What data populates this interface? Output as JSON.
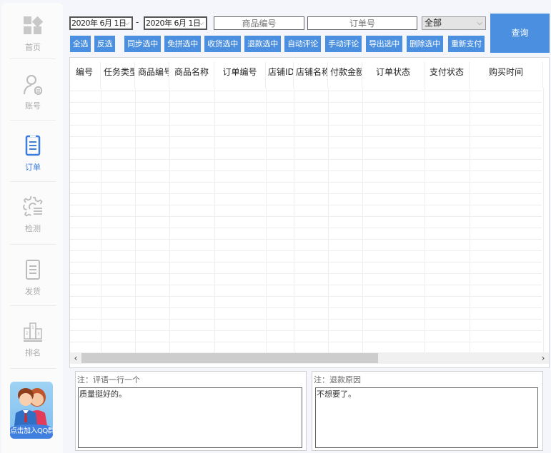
{
  "sidebar": {
    "items": [
      {
        "label": "首页",
        "icon": "home-grid-icon",
        "active": false
      },
      {
        "label": "账号",
        "icon": "user-account-icon",
        "active": false
      },
      {
        "label": "订单",
        "icon": "order-clipboard-icon",
        "active": true
      },
      {
        "label": "检测",
        "icon": "gear-check-icon",
        "active": false
      },
      {
        "label": "发货",
        "icon": "shipping-clipboard-icon",
        "active": false
      },
      {
        "label": "排名",
        "icon": "podium-ranking-icon",
        "active": false
      }
    ],
    "qq_group_label": "点击加入QQ群"
  },
  "toolbar": {
    "date_from": "2020年 6月 1日",
    "date_to": "2020年 6月 1日",
    "date_separator": "-",
    "product_id_placeholder": "商品编号",
    "order_no_placeholder": "订单号",
    "status_select": "全部",
    "query_label": "查询",
    "buttons": [
      "全选",
      "反选",
      "同步选中",
      "免拼选中",
      "收货选中",
      "退款选中",
      "自动评论",
      "手动评论",
      "导出选中",
      "删除选中",
      "重新支付"
    ]
  },
  "table": {
    "columns": [
      "编号",
      "任务类型",
      "商品编号",
      "商品名称",
      "订单编号",
      "店铺ID",
      "店铺名称",
      "付款金额",
      "订单状态",
      "支付状态",
      "购买时间"
    ],
    "rows": []
  },
  "notes": {
    "review": {
      "label": "注：评语一行一个",
      "value": "质量挺好的。"
    },
    "refund": {
      "label": "注：退款原因",
      "value": "不想要了。"
    }
  },
  "colors": {
    "accent": "#4a8fe0",
    "active_nav": "#3d7fd8"
  }
}
